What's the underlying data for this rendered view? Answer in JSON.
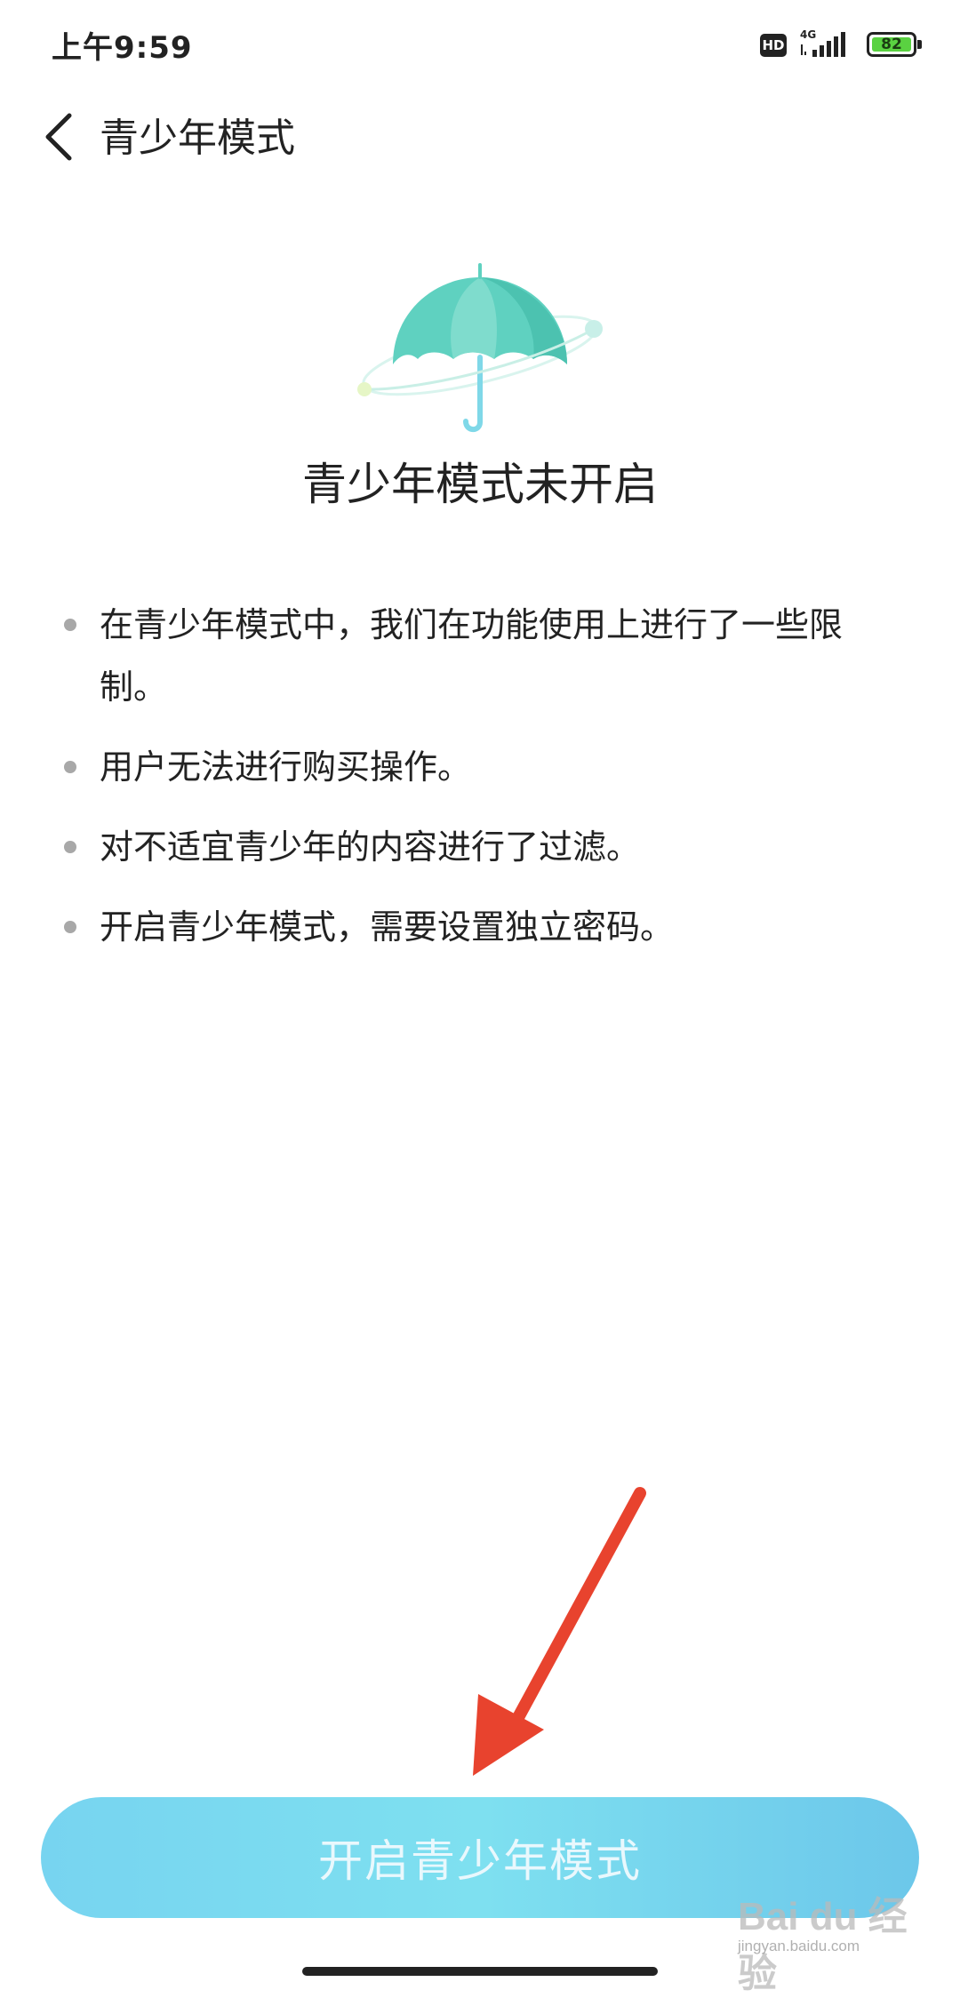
{
  "status_bar": {
    "time": "上午9:59",
    "hd_label": "HD",
    "network_label": "4G",
    "battery_level": "82",
    "battery_color": "#5ad241"
  },
  "header": {
    "back_icon": "chevron-left-icon",
    "title": "青少年模式"
  },
  "illustration": {
    "icon": "umbrella-icon",
    "color": "#5fd1c0"
  },
  "main": {
    "heading": "青少年模式未开启",
    "items": [
      {
        "text": "在青少年模式中，我们在功能使用上进行了一些限制。"
      },
      {
        "text": "用户无法进行购买操作。"
      },
      {
        "text": "对不适宜青少年的内容进行了过滤。"
      },
      {
        "text": "开启青少年模式，需要设置独立密码。"
      }
    ]
  },
  "annotation": {
    "icon": "red-arrow-icon",
    "color": "#e8432e"
  },
  "action": {
    "enable_label": "开启青少年模式",
    "accent": "#77d4f0"
  },
  "watermark": {
    "main": "Bai du 经验",
    "sub": "jingyan.baidu.com"
  }
}
